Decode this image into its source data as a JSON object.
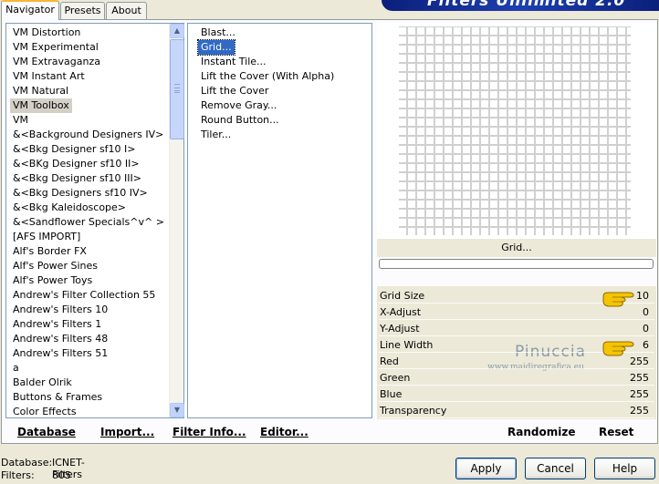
{
  "tabs": [
    "Navigator",
    "Presets",
    "About"
  ],
  "banner": {
    "title": "Filters Unlimited 2.0"
  },
  "categories": [
    "VM Distortion",
    "VM Experimental",
    "VM Extravaganza",
    "VM Instant Art",
    "VM Natural",
    "VM Toolbox",
    "VM",
    "&<Background Designers IV>",
    "&<Bkg Designer sf10 I>",
    "&<BKg Designer sf10 II>",
    "&<Bkg Designer sf10 III>",
    "&<Bkg Designers sf10 IV>",
    "&<Bkg Kaleidoscope>",
    "&<Sandflower Specials^v^ >",
    "[AFS IMPORT]",
    "Alf's Border FX",
    "Alf's Power Sines",
    "Alf's Power Toys",
    "Andrew's Filter Collection 55",
    "Andrew's Filters 10",
    "Andrew's Filters 1",
    "Andrew's Filters 48",
    "Andrew's Filters 51",
    "a",
    "Balder Olrik",
    "Buttons & Frames",
    "Color Effects"
  ],
  "selected_category": "VM Toolbox",
  "filters": [
    "Blast...",
    "Grid...",
    "Instant Tile...",
    "Lift the Cover (With Alpha)",
    "Lift the Cover",
    "Remove Gray...",
    "Round Button...",
    "Tiler..."
  ],
  "selected_filter": "Grid...",
  "preview": {
    "filter_name": "Grid...",
    "progress": 0
  },
  "params": [
    {
      "label": "Grid Size",
      "value": "10",
      "pointer": true
    },
    {
      "label": "X-Adjust",
      "value": "0",
      "pointer": false
    },
    {
      "label": "Y-Adjust",
      "value": "0",
      "pointer": false
    },
    {
      "label": "Line Width",
      "value": "6",
      "pointer": true
    },
    {
      "label": "Red",
      "value": "255",
      "pointer": false
    },
    {
      "label": "Green",
      "value": "255",
      "pointer": false
    },
    {
      "label": "Blue",
      "value": "255",
      "pointer": false
    },
    {
      "label": "Transparency",
      "value": "255",
      "pointer": false
    }
  ],
  "watermark": {
    "title": "Pinuccia",
    "url": "www.maidiregrafica.eu"
  },
  "links": {
    "database": "Database",
    "import": "Import...",
    "filter_info": "Filter Info...",
    "editor": "Editor...",
    "randomize": "Randomize",
    "reset": "Reset"
  },
  "status": {
    "database_label": "Database:",
    "database_value": "ICNET-Filters",
    "filters_label": "Filters:",
    "filters_value": "805"
  },
  "buttons": {
    "apply": "Apply",
    "cancel": "Cancel",
    "help": "Help"
  },
  "icons": {
    "scroll_up": "scroll-up-arrow-icon",
    "scroll_down": "scroll-down-arrow-icon",
    "pointer": "pointing-hand-icon"
  }
}
